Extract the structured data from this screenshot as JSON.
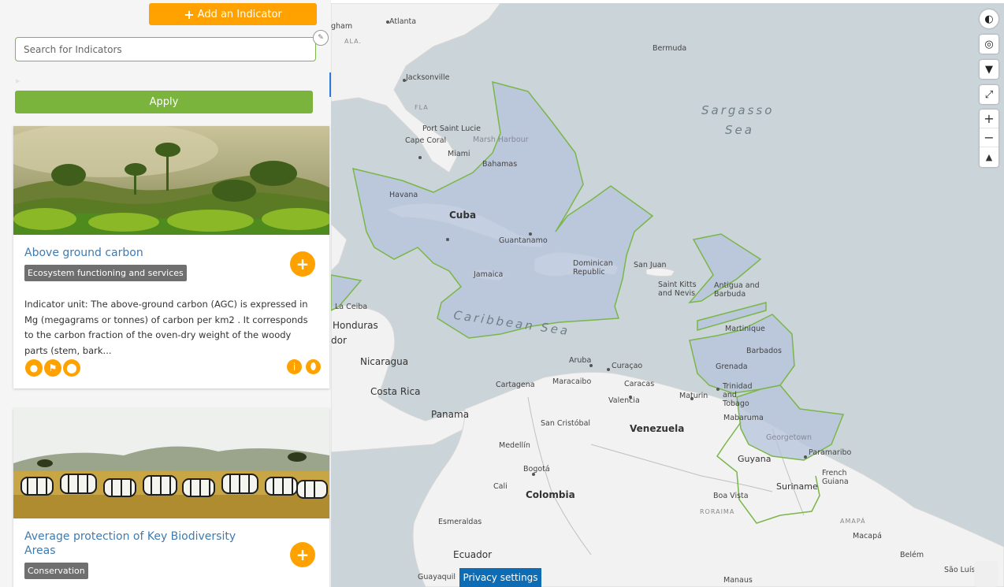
{
  "sidebar": {
    "add_button_label": "Add an Indicator",
    "search_placeholder": "Search for Indicators",
    "apply_label": "Apply",
    "cards": [
      {
        "title": "Above ground carbon",
        "tag": "Ecosystem functioning and services",
        "description": "Indicator unit: The above-ground carbon (AGC) is expressed in Mg (megagrams or tonnes) of carbon per km2 . It corresponds to the carbon fraction of the oven-dry weight of the woody parts (stem, bark...",
        "image": "rainforest-image"
      },
      {
        "title": "Average protection of Key Biodiversity Areas",
        "tag": "Conservation",
        "image": "zebras-savanna-image"
      }
    ]
  },
  "map": {
    "labels": {
      "atlanta": "Atlanta",
      "bermuda": "Bermuda",
      "jacksonville": "Jacksonville",
      "fla": "FLA",
      "ala": "ALA.",
      "gham": "gham",
      "sargasso": "Sargasso",
      "sea": "Sea",
      "port_saint_lucie": "Port Saint Lucie",
      "cape_coral": "Cape Coral",
      "miami": "Miami",
      "marsh_harbour": "Marsh Harbour",
      "bahamas": "Bahamas",
      "havana": "Havana",
      "cuba": "Cuba",
      "guantanamo": "Guantanamo",
      "jamaica": "Jamaica",
      "dominican_republic": "Dominican Republic",
      "san_juan": "San Juan",
      "saint_kitts": "Saint Kitts and Nevis",
      "antigua": "Antigua and Barbuda",
      "caribbean_sea": "Caribbean Sea",
      "martinique": "Martinique",
      "barbados": "Barbados",
      "grenada": "Grenada",
      "trinidad": "Trinidad and Tobago",
      "la_ceiba": "La Ceiba",
      "honduras": "Honduras",
      "dor": "dor",
      "nicaragua": "Nicaragua",
      "costa_rica": "Costa Rica",
      "panama": "Panama",
      "aruba": "Aruba",
      "curacao": "Curaçao",
      "cartagena": "Cartagena",
      "maracaibo": "Maracaibo",
      "caracas": "Caracas",
      "maturin": "Maturin",
      "valencia": "Valencia",
      "venezuela": "Venezuela",
      "san_cristobal": "San Cristóbal",
      "mabaruma": "Mabaruma",
      "georgetown": "Georgetown",
      "guyana": "Guyana",
      "paramaribo": "Paramaribo",
      "suriname": "Suriname",
      "french_guiana": "French Guiana",
      "medellin": "Medellín",
      "bogota": "Bogotá",
      "cali": "Cali",
      "colombia": "Colombia",
      "boa_vista": "Boa Vista",
      "roraima": "RORAIMA",
      "amapa": "AMAPÁ",
      "macapa": "Macapá",
      "esmeraldas": "Esmeraldas",
      "ecuador": "Ecuador",
      "guayaquil": "Guayaquil",
      "manaus": "Manaus",
      "belem": "Belém",
      "sao_luis": "São Luís"
    },
    "privacy_label": "Privacy settings",
    "colors": {
      "region_fill": "#b6c3dc",
      "region_stroke": "#7ab648",
      "ocean": "#cbd4d8",
      "land": "#f2f2f2"
    }
  }
}
